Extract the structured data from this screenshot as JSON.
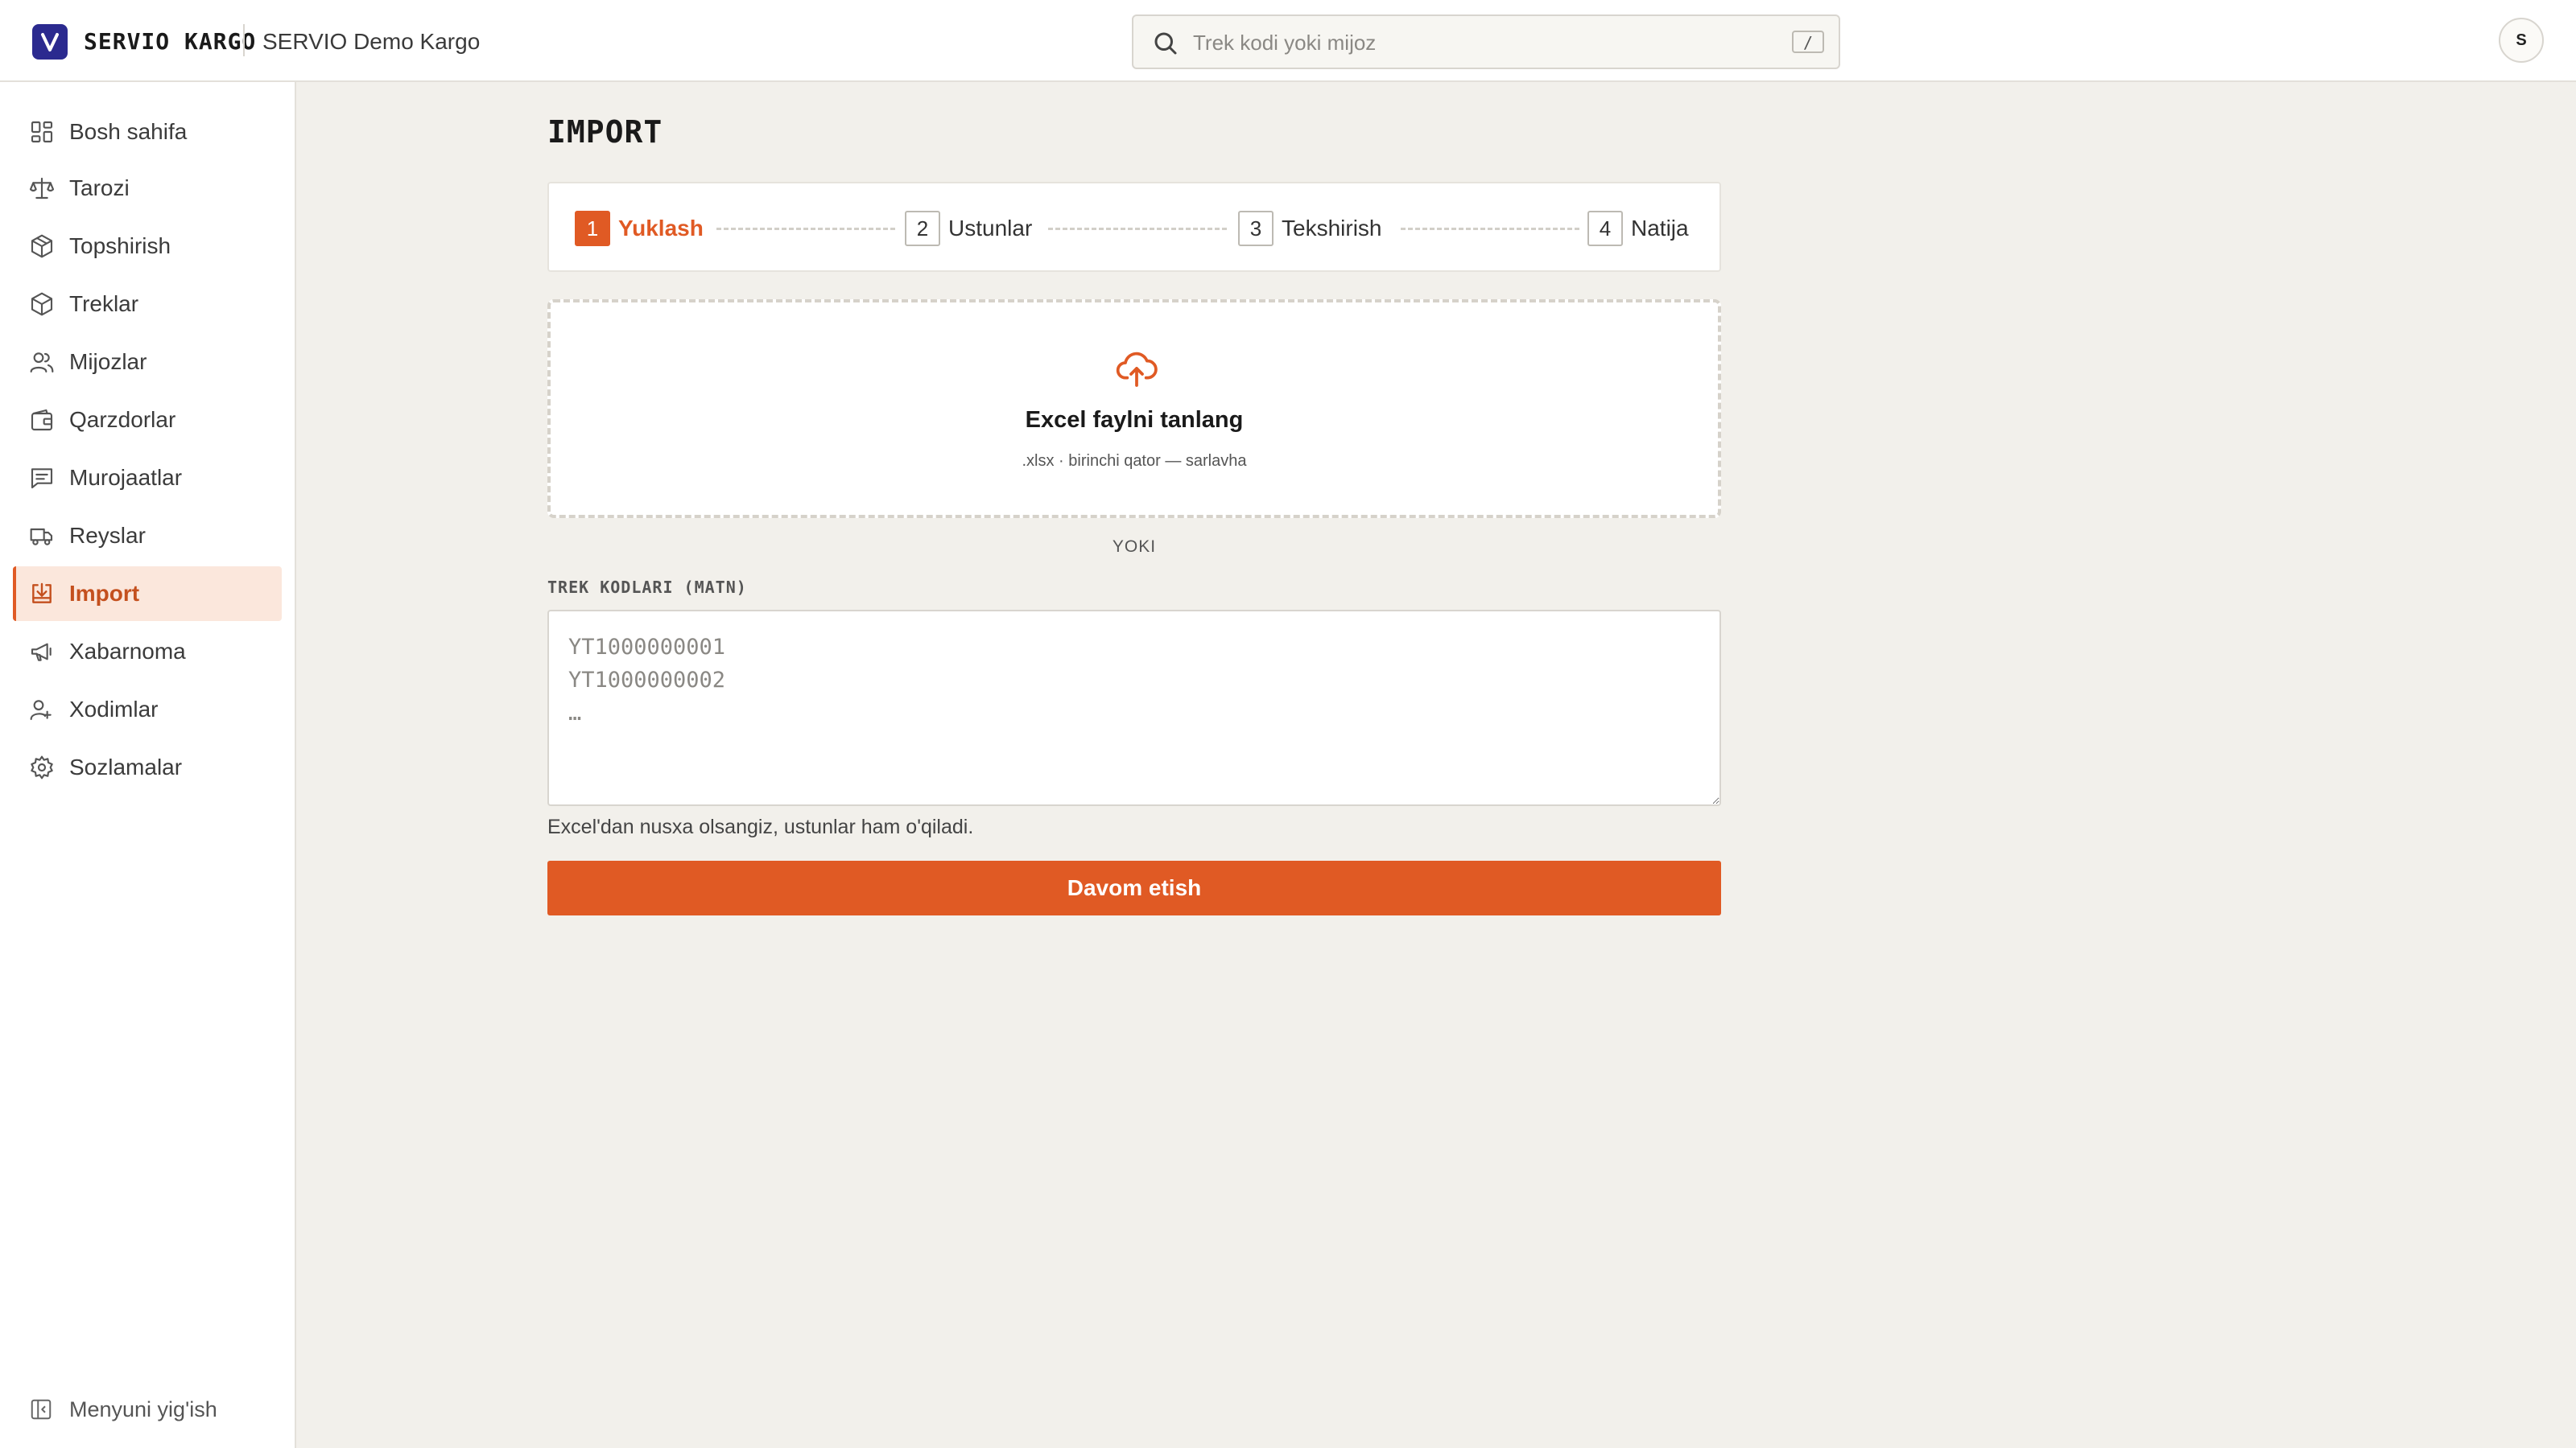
{
  "header": {
    "brand": "SERVIO KARGO",
    "org_name": "SERVIO Demo Kargo",
    "search_placeholder": "Trek kodi yoki mijoz",
    "search_shortcut": "/",
    "avatar_initial": "S"
  },
  "sidebar": {
    "items": [
      {
        "label": "Bosh sahifa",
        "icon": "dashboard-icon"
      },
      {
        "label": "Tarozi",
        "icon": "scale-icon"
      },
      {
        "label": "Topshirish",
        "icon": "package-icon"
      },
      {
        "label": "Treklar",
        "icon": "box-icon"
      },
      {
        "label": "Mijozlar",
        "icon": "users-icon"
      },
      {
        "label": "Qarzdorlar",
        "icon": "wallet-icon"
      },
      {
        "label": "Murojaatlar",
        "icon": "message-icon"
      },
      {
        "label": "Reyslar",
        "icon": "truck-icon"
      },
      {
        "label": "Import",
        "icon": "import-icon",
        "active": true
      },
      {
        "label": "Xabarnoma",
        "icon": "megaphone-icon"
      },
      {
        "label": "Xodimlar",
        "icon": "staff-icon"
      },
      {
        "label": "Sozlamalar",
        "icon": "gear-icon"
      }
    ],
    "collapse_label": "Menyuni yig'ish"
  },
  "main": {
    "title": "IMPORT",
    "steps": [
      {
        "num": "1",
        "label": "Yuklash",
        "active": true
      },
      {
        "num": "2",
        "label": "Ustunlar"
      },
      {
        "num": "3",
        "label": "Tekshirish"
      },
      {
        "num": "4",
        "label": "Natija"
      }
    ],
    "dropzone": {
      "title": "Excel faylni tanlang",
      "subtitle": ".xlsx · birinchi qator — sarlavha"
    },
    "or_text": "YOKI",
    "textarea_label": "TREK KODLARI (MATN)",
    "textarea_placeholder": "YT1000000001\nYT1000000002\n…",
    "hint": "Excel'dan nusxa olsangiz, ustunlar ham o'qiladi.",
    "continue_label": "Davom etish"
  },
  "colors": {
    "accent": "#e05a24",
    "brand": "#2b2a8f",
    "active_bg": "#fbe7dc",
    "page_bg": "#f2f0eb"
  }
}
